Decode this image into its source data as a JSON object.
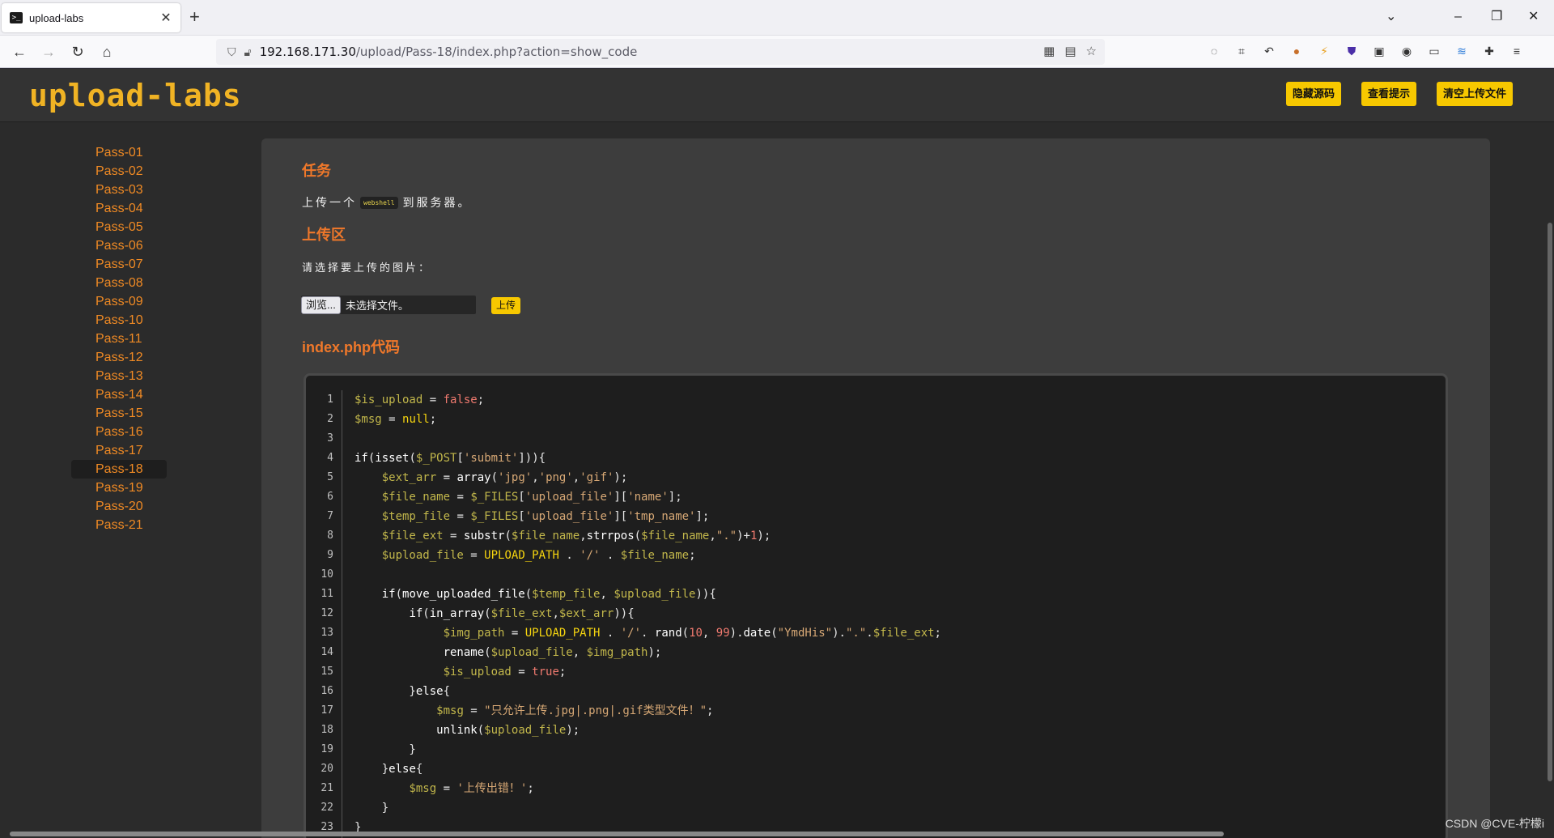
{
  "browser": {
    "tab_title": "upload-labs",
    "new_tab": "+",
    "url_host": "192.168.171.30",
    "url_path": "/upload/Pass-18/index.php?action=show_code"
  },
  "header": {
    "logo": "upload-labs",
    "buttons": [
      "隐藏源码",
      "查看提示",
      "清空上传文件"
    ]
  },
  "sidebar": {
    "items": [
      "Pass-01",
      "Pass-02",
      "Pass-03",
      "Pass-04",
      "Pass-05",
      "Pass-06",
      "Pass-07",
      "Pass-08",
      "Pass-09",
      "Pass-10",
      "Pass-11",
      "Pass-12",
      "Pass-13",
      "Pass-14",
      "Pass-15",
      "Pass-16",
      "Pass-17",
      "Pass-18",
      "Pass-19",
      "Pass-20",
      "Pass-21"
    ],
    "active": "Pass-18"
  },
  "task": {
    "title": "任务",
    "text_before": "上传一个",
    "chip": "webshell",
    "text_after": "到服务器。"
  },
  "upload": {
    "title": "上传区",
    "prompt": "请选择要上传的图片：",
    "browse_label": "浏览...",
    "file_status": "未选择文件。",
    "submit_label": "上传"
  },
  "code": {
    "title": "index.php代码",
    "lines": [
      "$is_upload = false;",
      "$msg = null;",
      "",
      "if(isset($_POST['submit'])){",
      "    $ext_arr = array('jpg','png','gif');",
      "    $file_name = $_FILES['upload_file']['name'];",
      "    $temp_file = $_FILES['upload_file']['tmp_name'];",
      "    $file_ext = substr($file_name,strrpos($file_name,\".\")+1);",
      "    $upload_file = UPLOAD_PATH . '/' . $file_name;",
      "",
      "    if(move_uploaded_file($temp_file, $upload_file)){",
      "        if(in_array($file_ext,$ext_arr)){",
      "             $img_path = UPLOAD_PATH . '/'. rand(10, 99).date(\"YmdHis\").\".\".$file_ext;",
      "             rename($upload_file, $img_path);",
      "             $is_upload = true;",
      "        }else{",
      "            $msg = \"只允许上传.jpg|.png|.gif类型文件！\";",
      "            unlink($upload_file);",
      "        }",
      "    }else{",
      "        $msg = '上传出错！';",
      "    }",
      "}"
    ]
  },
  "watermark": "CSDN @CVE-柠檬i"
}
